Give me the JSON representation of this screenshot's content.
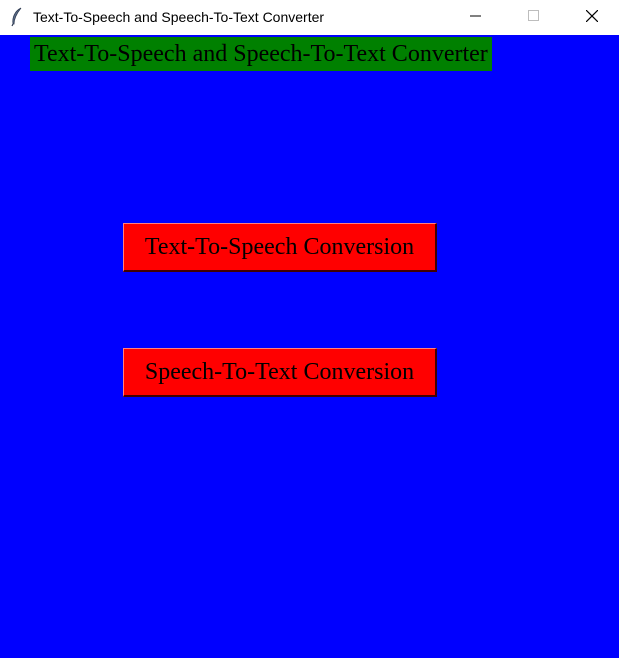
{
  "window": {
    "title": "Text-To-Speech and Speech-To-Text Converter",
    "app_icon": "feather-icon",
    "controls": [
      "minimize-icon",
      "maximize-icon",
      "close-icon"
    ]
  },
  "main": {
    "heading": "Text-To-Speech and Speech-To-Text Converter",
    "buttons": [
      {
        "label": "Text-To-Speech Conversion"
      },
      {
        "label": "Speech-To-Text Conversion"
      }
    ]
  },
  "colors": {
    "background": "#0000ff",
    "heading_background": "#008000",
    "button_background": "#ff0000"
  }
}
